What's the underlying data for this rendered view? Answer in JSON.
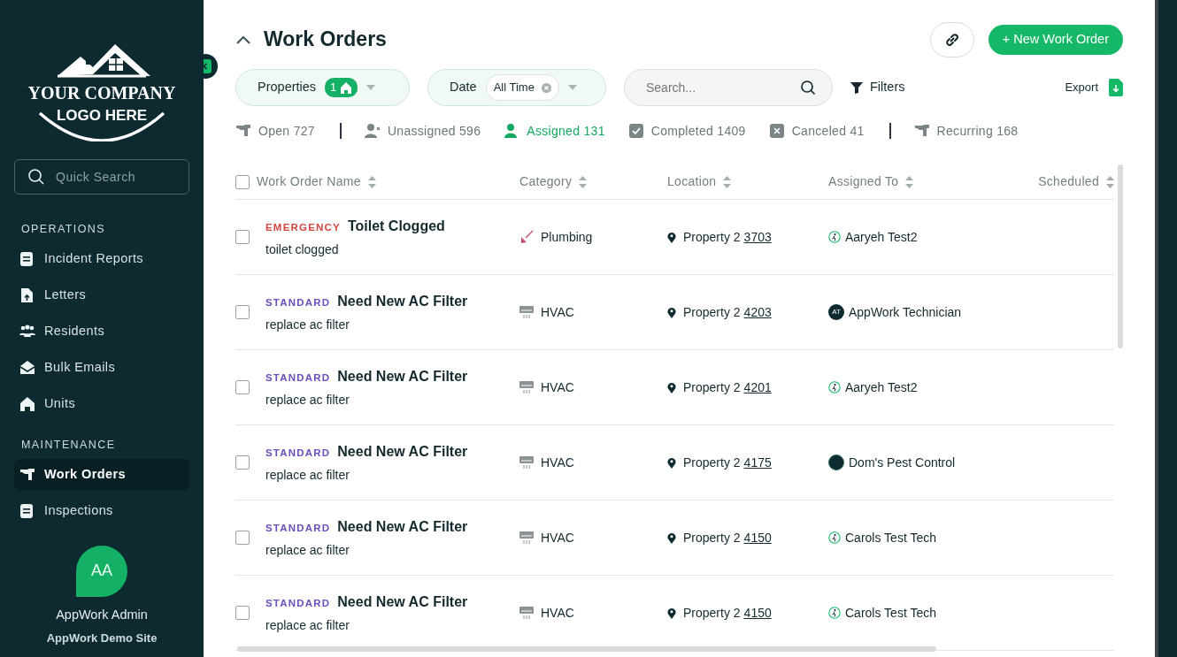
{
  "sidebar": {
    "logo": {
      "line1": "YOUR COMPANY",
      "line2": "LOGO HERE"
    },
    "search": {
      "placeholder": "Quick Search"
    },
    "sections": [
      {
        "title": "OPERATIONS",
        "items": [
          {
            "label": "Incident Reports",
            "kind": "doc",
            "selected": false
          },
          {
            "label": "Letters",
            "kind": "file",
            "selected": false
          },
          {
            "label": "Residents",
            "kind": "people",
            "selected": false
          },
          {
            "label": "Bulk Emails",
            "kind": "mail",
            "selected": false
          },
          {
            "label": "Units",
            "kind": "home",
            "selected": false
          }
        ]
      },
      {
        "title": "MAINTENANCE",
        "items": [
          {
            "label": "Work Orders",
            "kind": "tool",
            "selected": true
          },
          {
            "label": "Inspections",
            "kind": "doc",
            "selected": false
          }
        ]
      }
    ],
    "user": {
      "initials": "AA",
      "name": "AppWork Admin",
      "site": "AppWork Demo Site"
    }
  },
  "header": {
    "title": "Work Orders",
    "new_button": "+ New Work Order"
  },
  "filters": {
    "properties": {
      "label": "Properties",
      "count": "1"
    },
    "date": {
      "label": "Date",
      "value": "All Time"
    },
    "search": {
      "placeholder": "Search..."
    },
    "filters_button": "Filters",
    "export_button": "Export"
  },
  "status_tabs": [
    {
      "label": "Open 727",
      "kind": "tool",
      "selected": false,
      "divider_after": true
    },
    {
      "label": "Unassigned 596",
      "kind": "user-x",
      "selected": false,
      "divider_after": false
    },
    {
      "label": "Assigned 131",
      "kind": "user",
      "selected": true,
      "divider_after": false
    },
    {
      "label": "Completed 1409",
      "kind": "check",
      "selected": false,
      "divider_after": false
    },
    {
      "label": "Canceled 41",
      "kind": "x",
      "selected": false,
      "divider_after": true
    },
    {
      "label": "Recurring 168",
      "kind": "tool",
      "selected": false,
      "divider_after": false
    }
  ],
  "table": {
    "select_all": {
      "checked": false
    },
    "columns": [
      "Work Order Name",
      "Category",
      "Location",
      "Assigned To",
      "Scheduled"
    ],
    "rows": [
      {
        "checked": false,
        "priority": {
          "text": "EMERGENCY",
          "color": "#d6453d"
        },
        "title": "Toilet Clogged",
        "description": "toilet clogged",
        "category": {
          "kind": "plumbing",
          "text": "Plumbing"
        },
        "location": {
          "text": "Property 2",
          "unit": "3703"
        },
        "assignee": {
          "kind": "icon",
          "name": "Aaryeh Test2"
        }
      },
      {
        "checked": false,
        "priority": {
          "text": "STANDARD",
          "color": "#6b4fbb"
        },
        "title": "Need New AC Filter",
        "description": "replace ac filter",
        "category": {
          "kind": "hvac",
          "text": "HVAC"
        },
        "location": {
          "text": "Property 2",
          "unit": "4203"
        },
        "assignee": {
          "kind": "initials",
          "initials": "AT",
          "name": "AppWork Technician"
        }
      },
      {
        "checked": false,
        "priority": {
          "text": "STANDARD",
          "color": "#6b4fbb"
        },
        "title": "Need New AC Filter",
        "description": "replace ac filter",
        "category": {
          "kind": "hvac",
          "text": "HVAC"
        },
        "location": {
          "text": "Property 2",
          "unit": "4201"
        },
        "assignee": {
          "kind": "icon",
          "name": "Aaryeh Test2"
        }
      },
      {
        "checked": false,
        "priority": {
          "text": "STANDARD",
          "color": "#6b4fbb"
        },
        "title": "Need New AC Filter",
        "description": "replace ac filter",
        "category": {
          "kind": "hvac",
          "text": "HVAC"
        },
        "location": {
          "text": "Property 2",
          "unit": "4175"
        },
        "assignee": {
          "kind": "dot",
          "name": "Dom's Pest Control"
        }
      },
      {
        "checked": false,
        "priority": {
          "text": "STANDARD",
          "color": "#6b4fbb"
        },
        "title": "Need New AC Filter",
        "description": "replace ac filter",
        "category": {
          "kind": "hvac",
          "text": "HVAC"
        },
        "location": {
          "text": "Property 2",
          "unit": "4150"
        },
        "assignee": {
          "kind": "icon",
          "name": "Carols Test Tech"
        }
      },
      {
        "checked": false,
        "priority": {
          "text": "STANDARD",
          "color": "#6b4fbb"
        },
        "title": "Need New AC Filter",
        "description": "replace ac filter",
        "category": {
          "kind": "hvac",
          "text": "HVAC"
        },
        "location": {
          "text": "Property 2",
          "unit": "4150"
        },
        "assignee": {
          "kind": "icon",
          "name": "Carols Test Tech"
        }
      }
    ]
  }
}
